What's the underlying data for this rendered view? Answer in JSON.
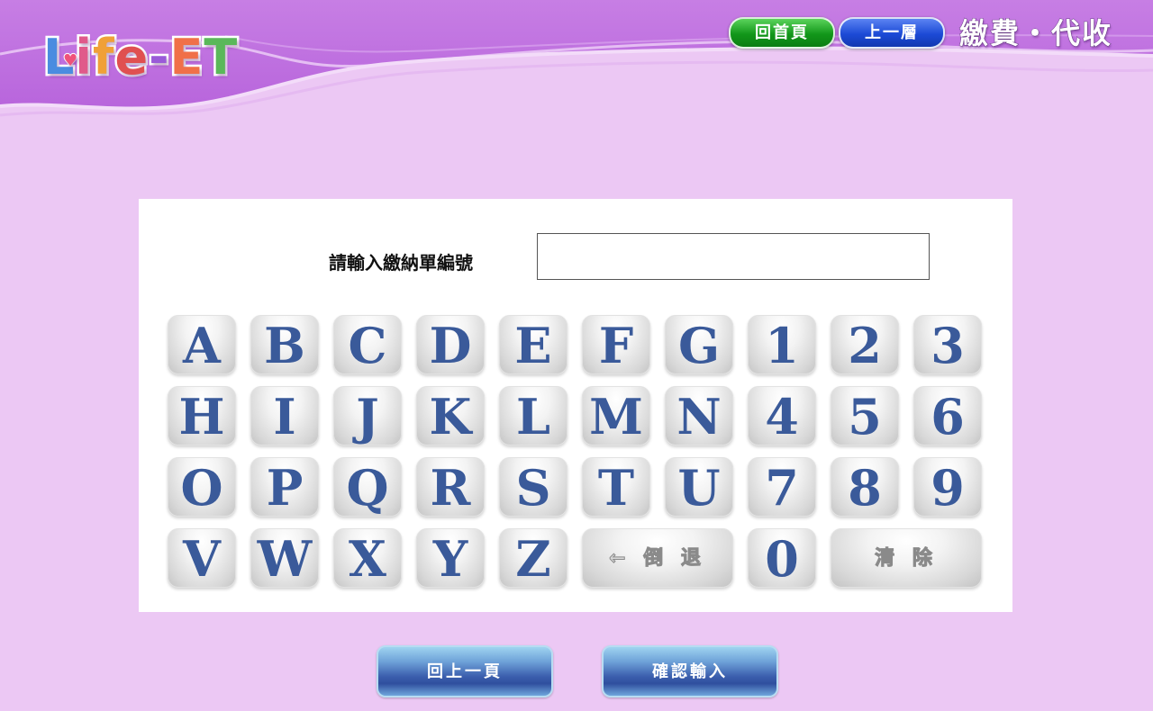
{
  "header": {
    "logo_text": [
      "L",
      "i",
      "f",
      "e",
      "-",
      "E",
      "T"
    ],
    "logo_colors": [
      "#4a8ce0",
      "#e05a8a",
      "#f0a038",
      "#e05050",
      "#9a5ad8",
      "#f07048",
      "#5ab85a"
    ],
    "home_label": "回首頁",
    "up_label": "上一層",
    "title": "繳費・代收"
  },
  "form": {
    "prompt": "請輸入繳納單編號",
    "input_value": ""
  },
  "keypad": {
    "keys": [
      [
        "A",
        "B",
        "C",
        "D",
        "E",
        "F",
        "G",
        "1",
        "2",
        "3"
      ],
      [
        "H",
        "I",
        "J",
        "K",
        "L",
        "M",
        "N",
        "4",
        "5",
        "6"
      ],
      [
        "O",
        "P",
        "Q",
        "R",
        "S",
        "T",
        "U",
        "7",
        "8",
        "9"
      ],
      [
        "V",
        "W",
        "X",
        "Y",
        "Z",
        "← 倒 退",
        "0",
        "清 除"
      ]
    ],
    "backspace_label": "← 倒 退",
    "clear_label": "清 除"
  },
  "footer": {
    "prev_label": "回上一頁",
    "confirm_label": "確認輸入"
  },
  "colors": {
    "background": "#ecc8f4",
    "banner": "#c070de",
    "key_text": "#3a5a9a"
  }
}
